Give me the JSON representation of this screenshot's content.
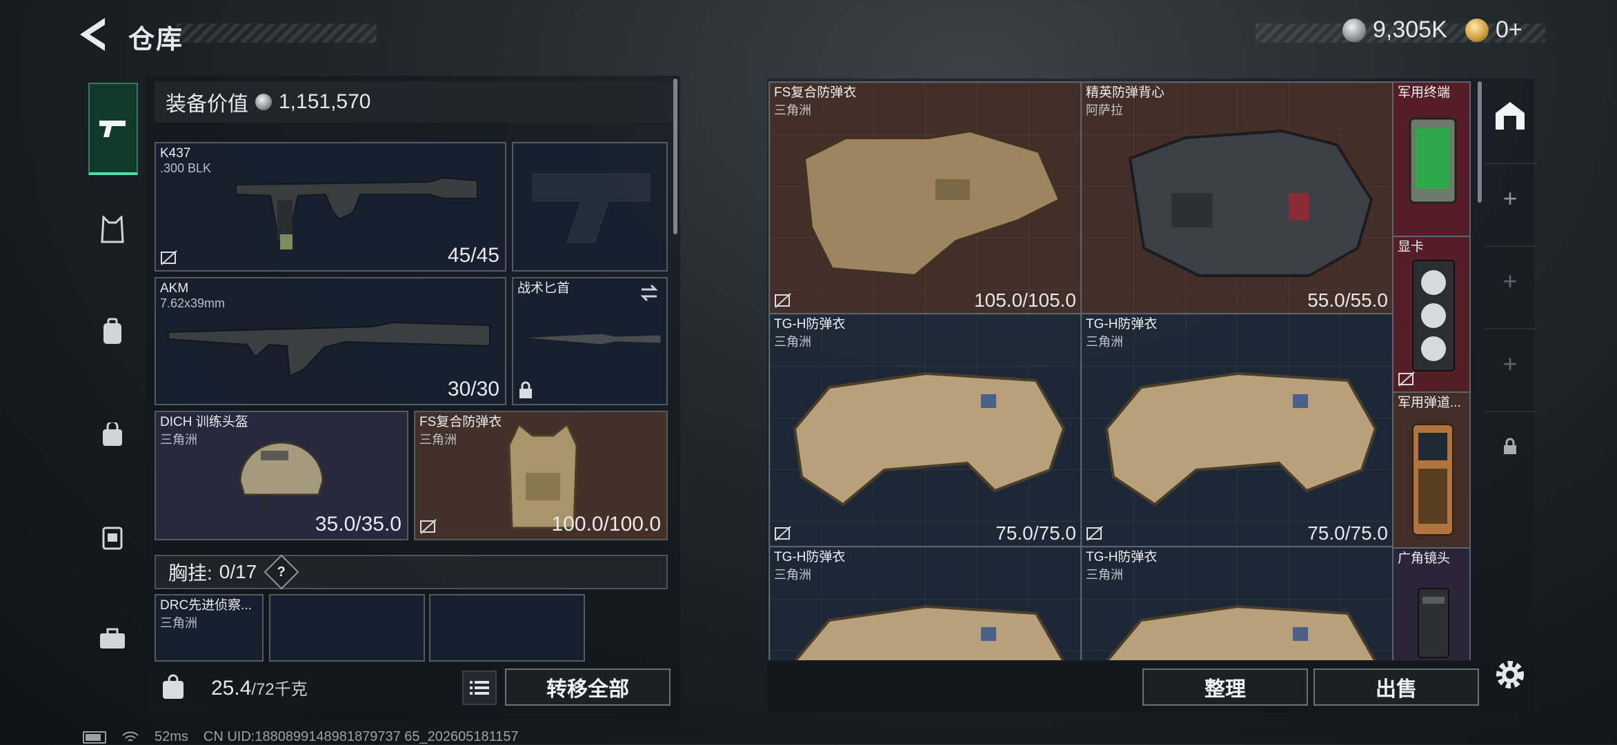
{
  "header": {
    "title": "仓库",
    "currency_silver": "9,305K",
    "currency_gold": "0+"
  },
  "left_rail": {
    "items": [
      {
        "icon": "pistol-icon",
        "active": true
      },
      {
        "icon": "body-armor-icon"
      },
      {
        "icon": "backpack-icon"
      },
      {
        "icon": "bag-icon"
      },
      {
        "icon": "chest-rig-icon"
      },
      {
        "icon": "toolbox-icon"
      }
    ]
  },
  "equipment": {
    "label": "装备价值",
    "value": "1,151,570",
    "primary_weapon": {
      "name": "K437",
      "sub": ".300 BLK",
      "durability": "45/45"
    },
    "secondary_weapon": {
      "name": "AKM",
      "sub": "7.62x39mm",
      "durability": "30/30"
    },
    "melee": {
      "name": "战术匕首"
    },
    "helmet": {
      "name": "DICH 训练头盔",
      "sub": "三角洲",
      "durability": "35.0/35.0"
    },
    "armor": {
      "name": "FS复合防弹衣",
      "sub": "三角洲",
      "durability": "100.0/100.0"
    }
  },
  "chest_rig": {
    "label": "胸挂:",
    "count": "0/17",
    "help": "?",
    "item_name": "DRC先进侦察...",
    "item_sub": "三角洲"
  },
  "left_bottom": {
    "weight": "25.4",
    "weight_cap": "/72千克",
    "transfer_all": "转移全部"
  },
  "storage": {
    "items": [
      {
        "name": "FS复合防弹衣",
        "sub": "三角洲",
        "durability": "105.0/105.0"
      },
      {
        "name": "精英防弹背心",
        "sub": "阿萨拉",
        "durability": "55.0/55.0"
      },
      {
        "name": "军用终端",
        "sub": ""
      },
      {
        "name": "TG-H防弹衣",
        "sub": "三角洲",
        "durability": "75.0/75.0"
      },
      {
        "name": "TG-H防弹衣",
        "sub": "三角洲",
        "durability": "75.0/75.0"
      },
      {
        "name": "显卡",
        "sub": ""
      },
      {
        "name": "军用弹道...",
        "sub": ""
      },
      {
        "name": "TG-H防弹衣",
        "sub": "三角洲"
      },
      {
        "name": "TG-H防弹衣",
        "sub": "三角洲"
      },
      {
        "name": "广角镜头",
        "sub": ""
      }
    ]
  },
  "right_bottom": {
    "sort": "整理",
    "sell": "出售"
  },
  "status": {
    "ping": "52ms",
    "uid": "CN UID:1880899148981879737 65_202605181157"
  }
}
